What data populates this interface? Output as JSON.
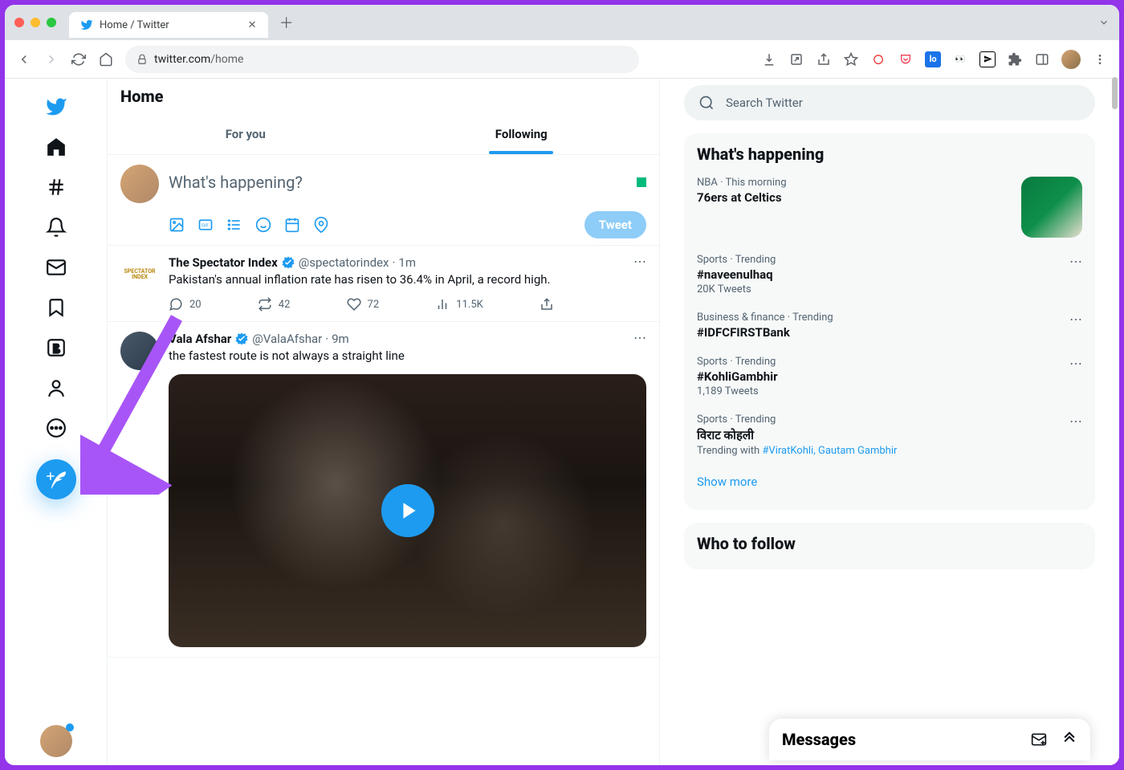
{
  "browser": {
    "tab_title": "Home / Twitter",
    "url_host": "twitter.com",
    "url_path": "/home"
  },
  "header": {
    "title": "Home"
  },
  "tabs": {
    "for_you": "For you",
    "following": "Following"
  },
  "composer": {
    "placeholder": "What's happening?",
    "button": "Tweet"
  },
  "tweets": [
    {
      "avatar_text": "SPECTATOR INDEX",
      "name": "The Spectator Index",
      "handle": "@spectatorindex",
      "time": "1m",
      "text": "Pakistan's annual inflation rate has risen to 36.4% in April, a record high.",
      "replies": "20",
      "retweets": "42",
      "likes": "72",
      "views": "11.5K"
    },
    {
      "name": "Vala Afshar",
      "handle": "@ValaAfshar",
      "time": "9m",
      "text": "the fastest route is not always a straight line"
    }
  ],
  "search": {
    "placeholder": "Search Twitter"
  },
  "whats_happening": {
    "title": "What's happening",
    "items": [
      {
        "meta": "NBA · This morning",
        "title": "76ers at Celtics",
        "has_thumb": true
      },
      {
        "meta": "Sports · Trending",
        "title": "#naveenulhaq",
        "sub": "20K Tweets"
      },
      {
        "meta": "Business & finance · Trending",
        "title": "#IDFCFIRSTBank"
      },
      {
        "meta": "Sports · Trending",
        "title": "#KohliGambhir",
        "sub": "1,189 Tweets"
      },
      {
        "meta": "Sports · Trending",
        "title": "विराट कोहली",
        "sub_prefix": "Trending with ",
        "links": "#ViratKohli, Gautam Gambhir"
      }
    ],
    "show_more": "Show more"
  },
  "who_to_follow": {
    "title": "Who to follow"
  },
  "messages": {
    "title": "Messages"
  }
}
